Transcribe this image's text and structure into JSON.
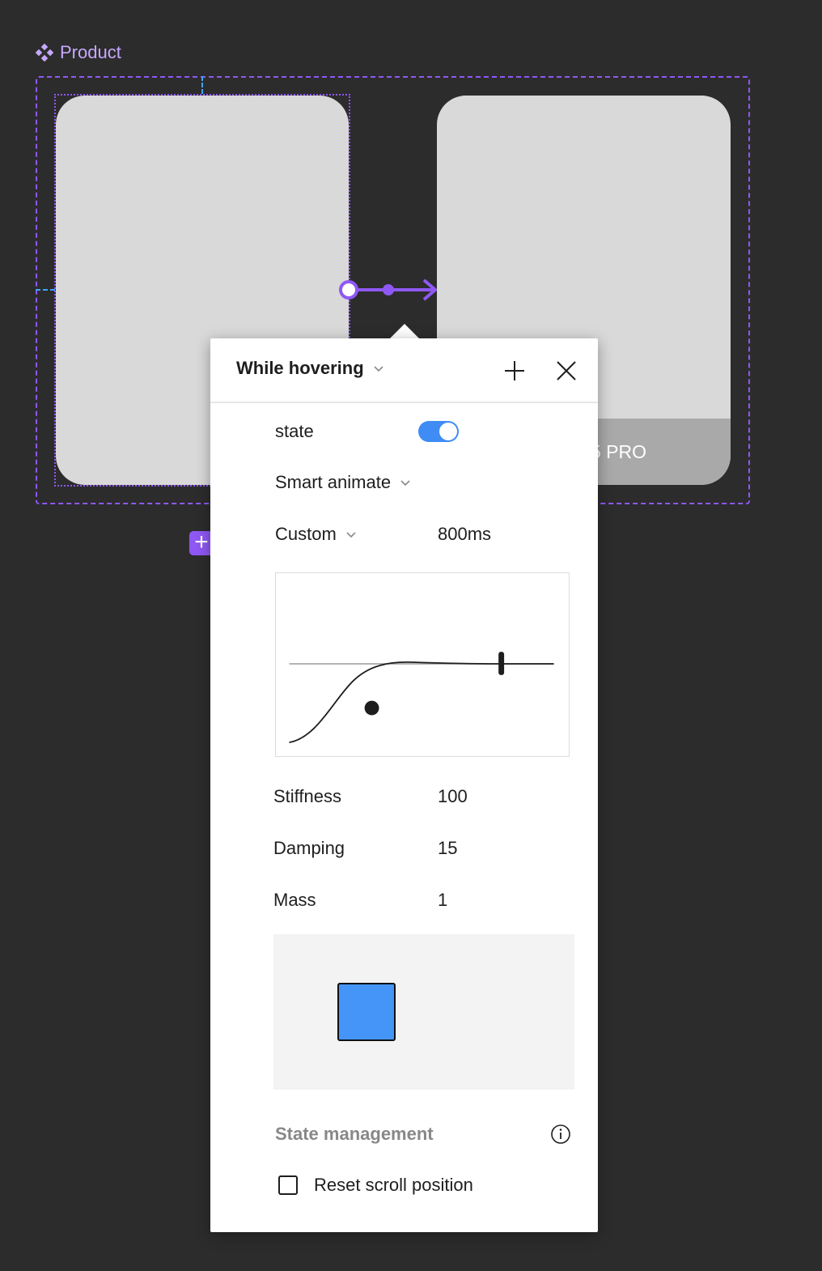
{
  "component": {
    "label": "Product",
    "variant_b_caption": "5 PRO"
  },
  "colors": {
    "canvas_bg": "#2c2c2c",
    "component_purple": "#8f58f5",
    "guide_blue": "#3da5ff",
    "toggle_blue": "#3f8cf5",
    "preview_square": "#4495f7"
  },
  "popover": {
    "trigger_label": "While hovering",
    "header_icons": [
      "chevron-down-icon",
      "plus-icon",
      "close-icon"
    ],
    "state_label": "state",
    "state_toggle_on": true,
    "animation_label": "Smart animate",
    "easing_label": "Custom",
    "duration_value": "800ms",
    "stiffness_label": "Stiffness",
    "stiffness_value": "100",
    "damping_label": "Damping",
    "damping_value": "15",
    "mass_label": "Mass",
    "mass_value": "1",
    "state_management_title": "State management",
    "reset_scroll_label": "Reset scroll position",
    "reset_scroll_checked": false
  }
}
